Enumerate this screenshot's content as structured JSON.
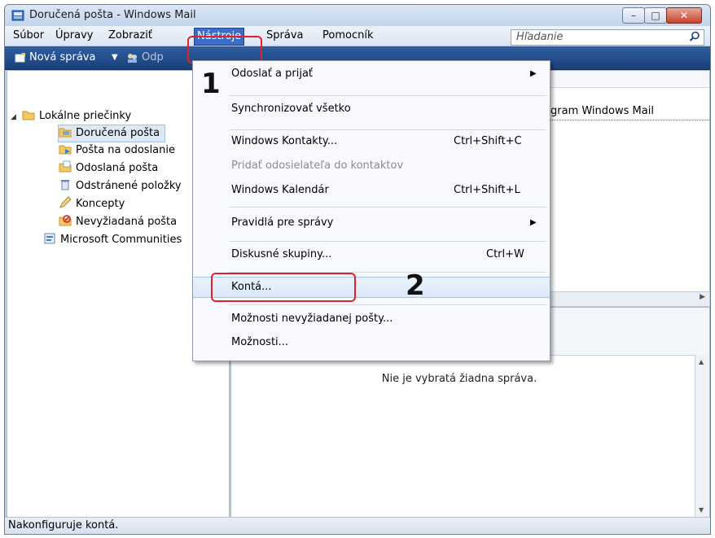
{
  "window": {
    "title": "Doručená pošta - Windows Mail"
  },
  "menubar": {
    "items": [
      {
        "label": "Súbor"
      },
      {
        "label": "Úpravy"
      },
      {
        "label": "Zobraziť"
      },
      {
        "label": "Nástroje"
      },
      {
        "label": "Správa"
      },
      {
        "label": "Pomocník"
      }
    ],
    "active": "Nástroje"
  },
  "search": {
    "placeholder": "Hľadanie"
  },
  "toolbar": {
    "new_message": "Nová správa",
    "reply_partial": "Odp"
  },
  "folders": {
    "root": "Lokálne priečinky",
    "items": [
      {
        "label": "Doručená pošta",
        "selected": true
      },
      {
        "label": "Pošta na odoslanie"
      },
      {
        "label": "Odoslaná pošta"
      },
      {
        "label": "Odstránené položky"
      },
      {
        "label": "Koncepty"
      },
      {
        "label": "Nevyžiadaná pošta"
      }
    ],
    "communities": "Microsoft Communities"
  },
  "message_list": {
    "partial_sender": "gram Windows Mail"
  },
  "preview": {
    "no_selection": "Nie je vybratá žiadna správa."
  },
  "statusbar": {
    "text": "Nakonfiguruje kontá."
  },
  "dropdown": {
    "items": [
      {
        "label": "Odoslať a prijať",
        "submenu": true
      },
      {
        "label": "Synchronizovať všetko"
      },
      {
        "label": "Windows Kontakty...",
        "shortcut": "Ctrl+Shift+C"
      },
      {
        "label": "Pridať odosielateľa do kontaktov",
        "disabled": true
      },
      {
        "label": "Windows Kalendár",
        "shortcut": "Ctrl+Shift+L"
      },
      {
        "label": "Pravidlá pre správy",
        "submenu": true
      },
      {
        "label": "Diskusné skupiny...",
        "shortcut": "Ctrl+W"
      },
      {
        "label": "Kontá...",
        "highlighted": true
      },
      {
        "label": "Možnosti nevyžiadanej pošty..."
      },
      {
        "label": "Možnosti..."
      }
    ]
  },
  "annotations": {
    "step1": "1",
    "step2": "2",
    "highlight_color": "#e3202a"
  }
}
